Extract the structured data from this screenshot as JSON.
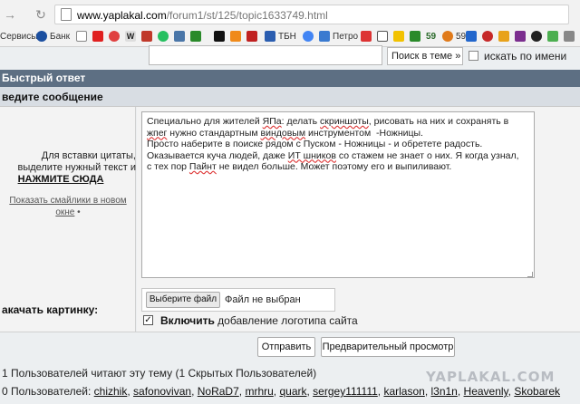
{
  "browser": {
    "url_host": "www.yaplakal.com",
    "url_path": "/forum1/st/125/topic1633749.html",
    "bookmarks": [
      {
        "label": "Сервисы",
        "icon": "apps-grid-icon",
        "color": "#4a7bd4"
      },
      {
        "label": "Банк",
        "icon": "bank-icon",
        "color": "#1b4fa0"
      }
    ],
    "bookmark_icons": [
      {
        "name": "doc-icon",
        "color": "#ffffff"
      },
      {
        "name": "youtube-icon",
        "color": "#e02020"
      },
      {
        "name": "mail-icon",
        "color": "#e04040"
      },
      {
        "name": "wiki-icon",
        "color": "#ffffff"
      },
      {
        "name": "whatsapp-icon",
        "color": "#25c060"
      },
      {
        "name": "vk-icon",
        "color": "#4a76a8"
      },
      {
        "name": "check-icon",
        "color": "#2a8a2a"
      },
      {
        "name": "news-icon",
        "color": "#111111"
      },
      {
        "name": "orange-icon",
        "color": "#f08a1a"
      },
      {
        "name": "tv-icon",
        "color": "#c02020"
      }
    ],
    "bookmark_tbn": "ТБН",
    "bookmark_petro": "Петро",
    "bookmark_nums": [
      "59",
      "59"
    ]
  },
  "search": {
    "select_label": "Поиск в теме »",
    "name_label": "искать по имени"
  },
  "form": {
    "quick_reply": "Быстрый ответ",
    "enter_message": "ведите сообщение",
    "quote_hint_1": "Для вставки цитаты,",
    "quote_hint_2": "выделите нужный текст и",
    "click_here": "НАЖМИТЕ СЮДА",
    "smiles_link_1": "Показать смайлики в новом",
    "smiles_link_2": "окне",
    "message_text_parts": [
      "Специально для жителей ",
      "ЯПа",
      ": делать ",
      "скриншоты",
      ", рисовать на них и сохранять в\n",
      "жпег",
      " нужно стандартным ",
      "виндовым",
      " инструментом  -Ножницы.\nПросто наберите в поиске рядом с Пуском - Ножницы - и обретете радость.\nОказывается куча людей, даже ",
      "ИТ шников",
      " со стажем не знает о них. Я когда узнал,\nс тех пор ",
      "Пайнт",
      " не видел больше. Может поэтому его и выпиливают."
    ],
    "upload_label": "акачать картинку:",
    "choose_file": "Выберите файл",
    "no_file": "Файл не выбран",
    "logo_bold": "Включить",
    "logo_rest": " добавление логотипа сайта",
    "send": "Отправить",
    "preview": "Предварительный просмотр"
  },
  "footer": {
    "readers": "1 Пользователей читают эту тему (1 Скрытых Пользователей)",
    "users_prefix": "0 Пользователей: ",
    "users": [
      "chizhik",
      "safonovivan",
      "NoRaD7",
      "mrhru",
      "quark",
      "sergey111111",
      "karlason",
      "l3n1n",
      "Heavenly",
      "Skobarek"
    ],
    "watermark": "YAPLAKAL.COM"
  }
}
